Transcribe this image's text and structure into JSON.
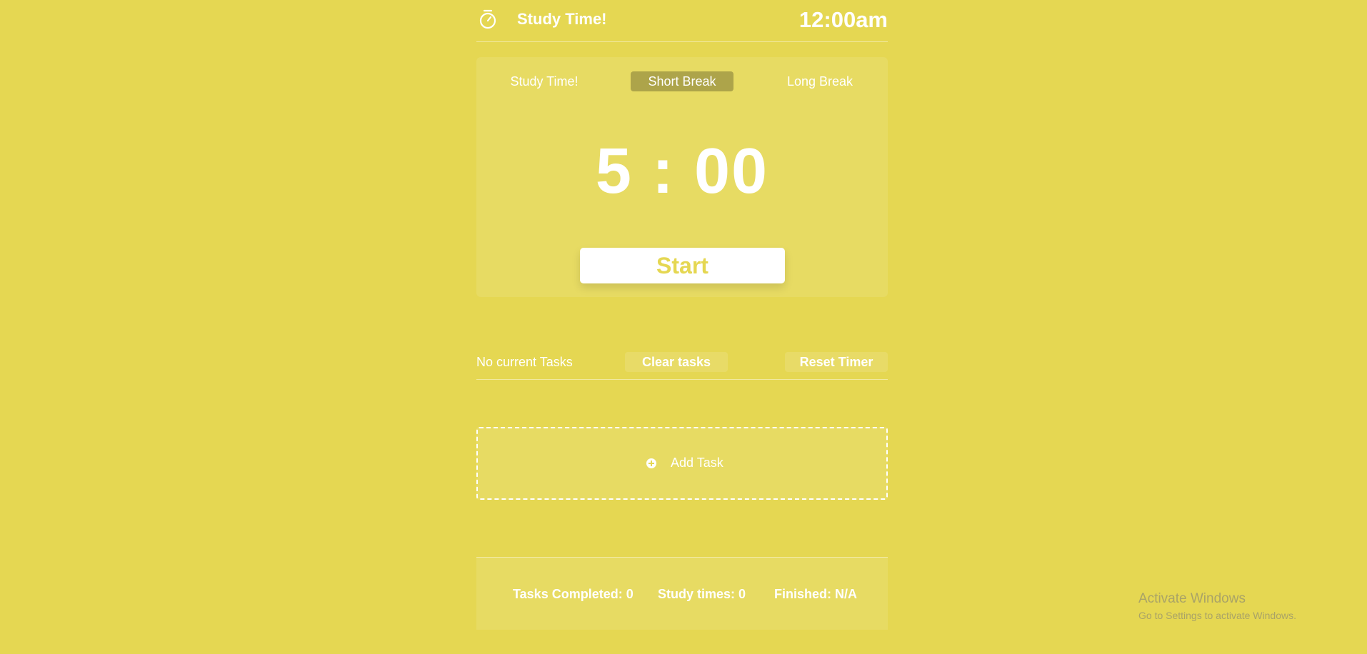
{
  "header": {
    "icon": "stopwatch-icon",
    "title": "Study Time!",
    "clock": "12:00am"
  },
  "timer": {
    "tabs": [
      {
        "label": "Study Time!",
        "active": false
      },
      {
        "label": "Short Break",
        "active": true
      },
      {
        "label": "Long Break",
        "active": false
      }
    ],
    "display": "5 : 00",
    "start_label": "Start"
  },
  "tasks": {
    "status": "No current Tasks",
    "clear_label": "Clear tasks",
    "reset_label": "Reset Timer",
    "add_label": "Add Task",
    "add_icon": "plus-circle-icon"
  },
  "stats": {
    "tasks_completed": "Tasks Completed: 0",
    "study_times": "Study times: 0",
    "finished": "Finished: N/A"
  },
  "watermark": {
    "title": "Activate Windows",
    "subtitle": "Go to Settings to activate Windows."
  },
  "colors": {
    "background": "#e5d752",
    "text": "#ffffff"
  }
}
